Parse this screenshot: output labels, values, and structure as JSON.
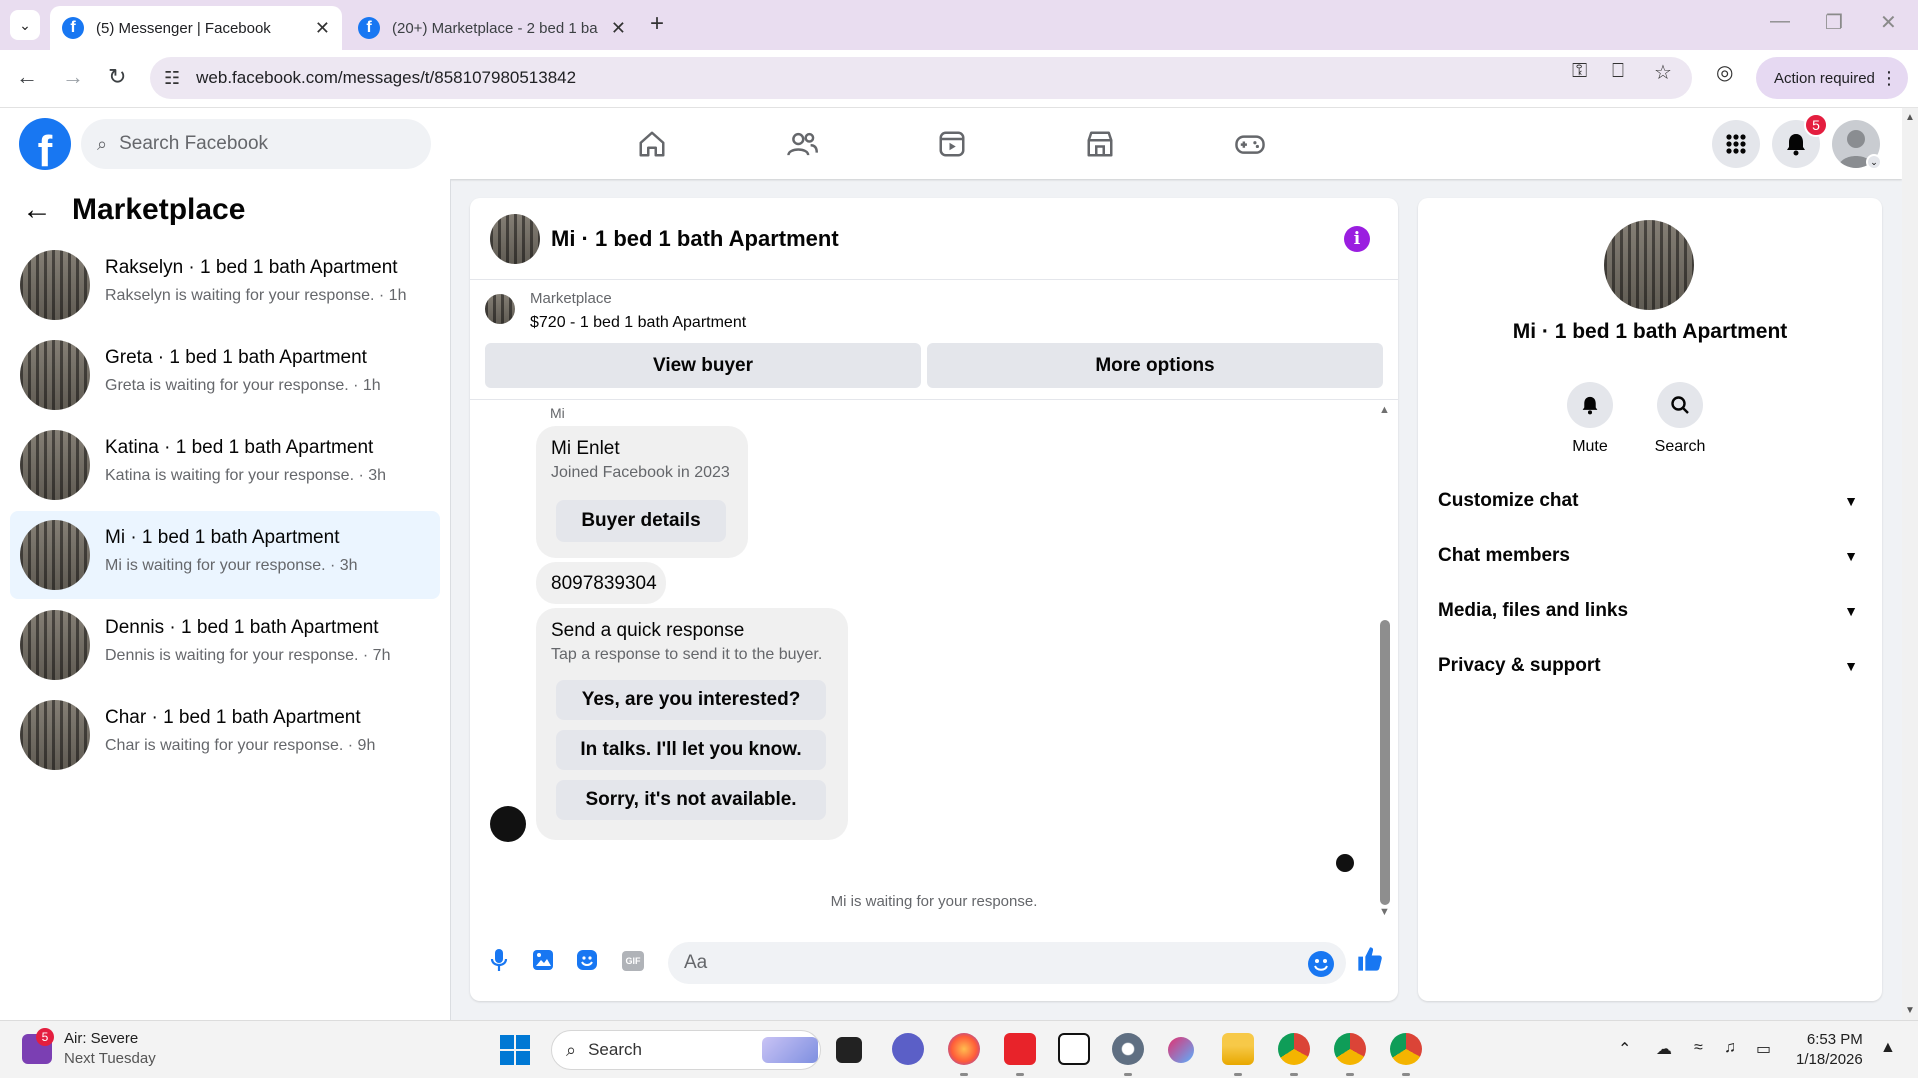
{
  "browser": {
    "tabs": [
      {
        "title": "(5) Messenger | Facebook",
        "active": true
      },
      {
        "title": "(20+) Marketplace - 2 bed 1 ba",
        "active": false
      }
    ],
    "url": "web.facebook.com/messages/t/858107980513842",
    "action_required": "Action required"
  },
  "fb_header": {
    "search_placeholder": "Search Facebook",
    "notification_count": "5",
    "icons": [
      "home-icon",
      "friends-icon",
      "video-icon",
      "marketplace-icon",
      "gaming-icon",
      "menu-grid-icon",
      "bell-icon"
    ]
  },
  "sidebar": {
    "title": "Marketplace",
    "conversations": [
      {
        "name": "Rakselyn · 1 bed 1 bath Apartment",
        "sub": "Rakselyn is waiting for your response. · 1h"
      },
      {
        "name": "Greta · 1 bed 1 bath Apartment",
        "sub": "Greta is waiting for your response. · 1h"
      },
      {
        "name": "Katina · 1 bed 1 bath Apartment",
        "sub": "Katina is waiting for your response. · 3h"
      },
      {
        "name": "Mi · 1 bed 1 bath Apartment",
        "sub": "Mi is waiting for your response. · 3h",
        "selected": true
      },
      {
        "name": "Dennis · 1 bed 1 bath Apartment",
        "sub": "Dennis is waiting for your response. · 7h"
      },
      {
        "name": "Char · 1 bed 1 bath Apartment",
        "sub": "Char is waiting for your response. · 9h"
      }
    ]
  },
  "chat": {
    "title": "Mi · 1 bed 1 bath Apartment",
    "marketplace_label": "Marketplace",
    "listing": "$720 - 1 bed 1 bath Apartment",
    "view_buyer": "View buyer",
    "more_options": "More options",
    "sender_name": "Mi",
    "buyer_card": {
      "name": "Mi Enlet",
      "joined": "Joined Facebook in 2023",
      "button": "Buyer details"
    },
    "phone_message": "8097839304",
    "quick_response": {
      "title": "Send a quick response",
      "subtitle": "Tap a response to send it to the buyer.",
      "options": [
        "Yes, are you interested?",
        "In talks. I'll let you know.",
        "Sorry, it's not available."
      ]
    },
    "waiting_text": "Mi is waiting for your response.",
    "composer_placeholder": "Aa"
  },
  "info_panel": {
    "title": "Mi · 1 bed 1 bath Apartment",
    "actions": [
      "Mute",
      "Search"
    ],
    "sections": [
      "Customize chat",
      "Chat members",
      "Media, files and links",
      "Privacy & support"
    ]
  },
  "taskbar": {
    "weather_badge": "5",
    "weather_title": "Air: Severe",
    "weather_sub": "Next Tuesday",
    "search_label": "Search",
    "time": "6:53 PM",
    "date": "1/18/2026"
  },
  "colors": {
    "fb_blue": "#1877f2",
    "selected_row": "#ebf5ff",
    "info_purple": "#9a1ee0",
    "badge_red": "#e41e3f"
  }
}
